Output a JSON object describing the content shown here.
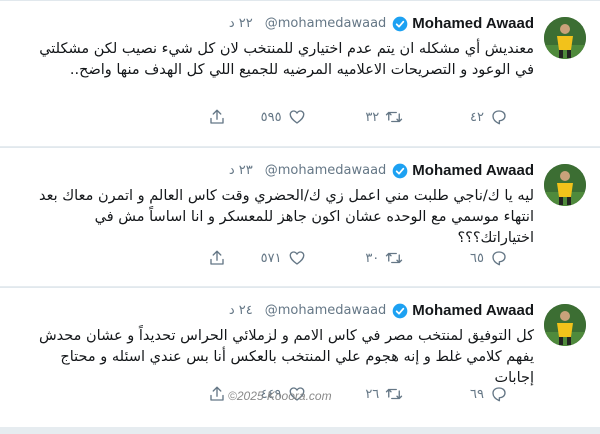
{
  "tweets": [
    {
      "name": "Mohamed Awaad",
      "handle": "@mohamedawaad",
      "time": "٢٢ د",
      "text": "معنديش أي مشكله ان يتم عدم اختياري للمنتخب لان كل شيء نصيب لكن مشكلتي في الوعود  و التصريحات الاعلاميه المرضيه للجميع اللي كل الهدف منها واضح..",
      "replies": "٤٢",
      "retweets": "٣٢",
      "likes": "٥٩٥"
    },
    {
      "name": "Mohamed Awaad",
      "handle": "@mohamedawaad",
      "time": "٢٣ د",
      "text": "ليه يا ك/ناجي طلبت مني اعمل زي ك/الحضري وقت كاس العالم و اتمرن معاك بعد انتهاء موسمي مع الوحده عشان اكون جاهز للمعسكر و انا اساساً مش في اختياراتك؟؟؟",
      "replies": "٦٥",
      "retweets": "٣٠",
      "likes": "٥٧١"
    },
    {
      "name": "Mohamed Awaad",
      "handle": "@mohamedawaad",
      "time": "٢٤ د",
      "text": "كل التوفيق لمنتخب مصر في كاس الامم و لزملائي الحراس تحديداً و عشان محدش يفهم كلامي غلط و إنه هجوم علي المنتخب بالعكس أنا بس عندي اسئله و محتاج إجابات",
      "replies": "٦٩",
      "retweets": "٢٦",
      "likes": "٤٤٩"
    }
  ],
  "watermark": "©2025 Kooora.com",
  "colors": {
    "verified": "#1da1f2",
    "muted": "#657786",
    "text": "#14171a"
  },
  "icons": [
    "reply-icon",
    "retweet-icon",
    "like-icon",
    "share-icon",
    "verified-badge-icon"
  ]
}
